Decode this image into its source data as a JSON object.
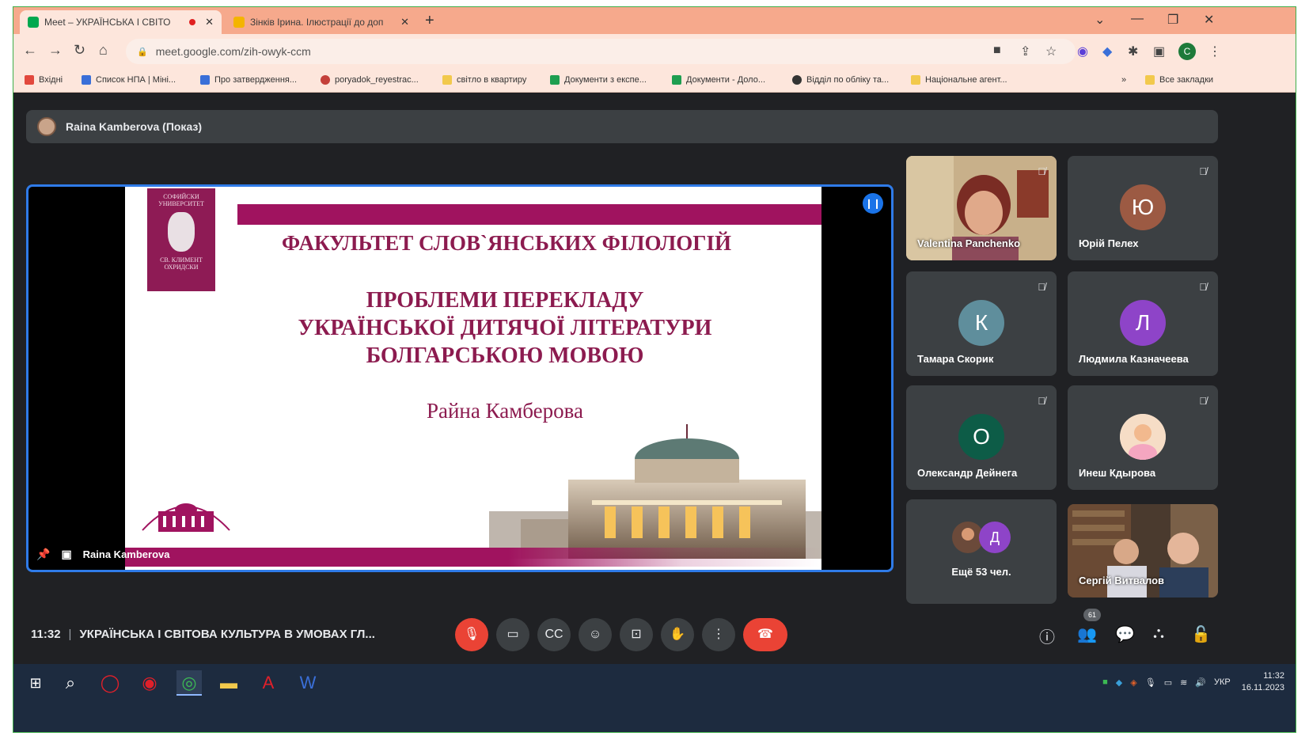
{
  "browser": {
    "tabs": [
      {
        "title": "Meet – УКРАЇНСЬКА І СВІТО",
        "active": true
      },
      {
        "title": "Зінків Ірина. Ілюстрації до доп",
        "active": false
      }
    ],
    "url": "meet.google.com/zih-owyk-ccm",
    "profile_initial": "C",
    "bookmarks": [
      {
        "label": "Вхідні",
        "icon": "gmail-icon",
        "color": "#e2483d"
      },
      {
        "label": "Список НПА | Міні...",
        "icon": "link-icon",
        "color": "#3a6fd8"
      },
      {
        "label": "Про затвердження...",
        "icon": "triangle-icon",
        "color": "#3a6fd8"
      },
      {
        "label": "poryadok_reyestrac...",
        "icon": "globe-icon",
        "color": "#c4403a"
      },
      {
        "label": "світло в квартиру",
        "icon": "folder-icon",
        "color": "#f2c94c"
      },
      {
        "label": "Документи з експе...",
        "icon": "sheets-icon",
        "color": "#1e9e50"
      },
      {
        "label": "Документи - Доло...",
        "icon": "sheets-icon",
        "color": "#1e9e50"
      },
      {
        "label": "Відділ по обліку та...",
        "icon": "globe-icon",
        "color": "#333333"
      },
      {
        "label": "Національне агент...",
        "icon": "folder-icon",
        "color": "#f2c94c"
      },
      {
        "label": "Все закладки",
        "icon": "folder-icon",
        "color": "#f2c94c"
      }
    ]
  },
  "meet": {
    "presenter_bar": "Raina Kamberova (Показ)",
    "stage_name": "Raina Kamberova",
    "slide": {
      "crest_top": "СОФИЙСКИ УНИВЕРСИТЕТ",
      "crest_bottom": "СВ. КЛИМЕНТ ОХРИДСКИ",
      "faculty": "ФАКУЛЬТЕТ СЛОВ`ЯНСЬКИХ ФІЛОЛОГІЙ",
      "title_line1": "ПРОБЛЕМИ ПЕРЕКЛАДУ",
      "title_line2": "УКРАЇНСЬКОЇ ДИТЯЧОЇ ЛІТЕРАТУРИ",
      "title_line3": "БОЛГАРСЬКОЮ МОВОЮ",
      "author": "Райна Камберова"
    },
    "participants": [
      {
        "name": "Valentina Panchenko",
        "type": "video"
      },
      {
        "name": "Юрій Пелех",
        "initial": "Ю",
        "color": "#9c5a43"
      },
      {
        "name": "Тамара Скорик",
        "initial": "К",
        "color": "#5f8e9c"
      },
      {
        "name": "Людмила Казначеева",
        "initial": "Л",
        "color": "#8e44c8"
      },
      {
        "name": "Олександр Дейнега",
        "initial": "О",
        "color": "#0d5c47"
      },
      {
        "name": "Инеш Кдырова",
        "type": "photo"
      },
      {
        "name": "Ещё 53 чел.",
        "initial": "Д",
        "color": "#8e44c8"
      },
      {
        "name": "Сергій Витвалов",
        "type": "video"
      }
    ],
    "clock": "11:32",
    "meeting_title": "УКРАЇНСЬКА І СВІТОВА КУЛЬТУРА В УМОВАХ ГЛ...",
    "participant_count": "61"
  },
  "taskbar": {
    "language": "УКР",
    "time": "11:32",
    "date": "16.11.2023"
  }
}
